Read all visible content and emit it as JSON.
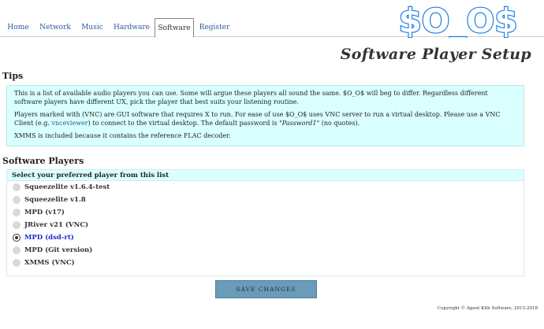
{
  "nav": {
    "tabs": [
      {
        "label": "Home"
      },
      {
        "label": "Network"
      },
      {
        "label": "Music"
      },
      {
        "label": "Hardware"
      },
      {
        "label": "Software",
        "active": true
      },
      {
        "label": "Register"
      }
    ]
  },
  "logo": {
    "text": "$O_O$",
    "color": "#1a7fe8"
  },
  "page_title": "Software Player Setup",
  "tips": {
    "heading": "Tips",
    "p1": "This is a list of available audio players you can use. Some will argue these players all sound the same. $O_O$ will beg to differ. Regardless different software players have different UX, pick the player that best suits your listening routine.",
    "p2_a": "Players marked with (VNC) are GUI software that requires X to run. For ease of use $O_O$ uses VNC server to run a virtual desktop. Please use a VNC Client (e.g. ",
    "p2_link": "vnceviewer",
    "p2_b": ") to connect to the virtual desktop. The default password is \"",
    "p2_password": "Password1",
    "p2_c": "\" (no quotes).",
    "p3": "XMMS is included because it contains the reference FLAC decoder."
  },
  "players": {
    "heading": "Software Players",
    "list_title": "Select your preferred player from this list",
    "items": [
      {
        "label": "Squeezelite v1.6.4-test",
        "selected": false
      },
      {
        "label": "Squeezelite v1.8",
        "selected": false
      },
      {
        "label": "MPD (v17)",
        "selected": false
      },
      {
        "label": "JRiver v21 (VNC)",
        "selected": false
      },
      {
        "label": "MPD (dsd-rt)",
        "selected": true
      },
      {
        "label": "MPD (Git version)",
        "selected": false
      },
      {
        "label": "XMMS (VNC)",
        "selected": false
      }
    ]
  },
  "save_label": "SAVE CHANGES",
  "footer": "Copyright © Agent Kith Software, 2015-2018"
}
